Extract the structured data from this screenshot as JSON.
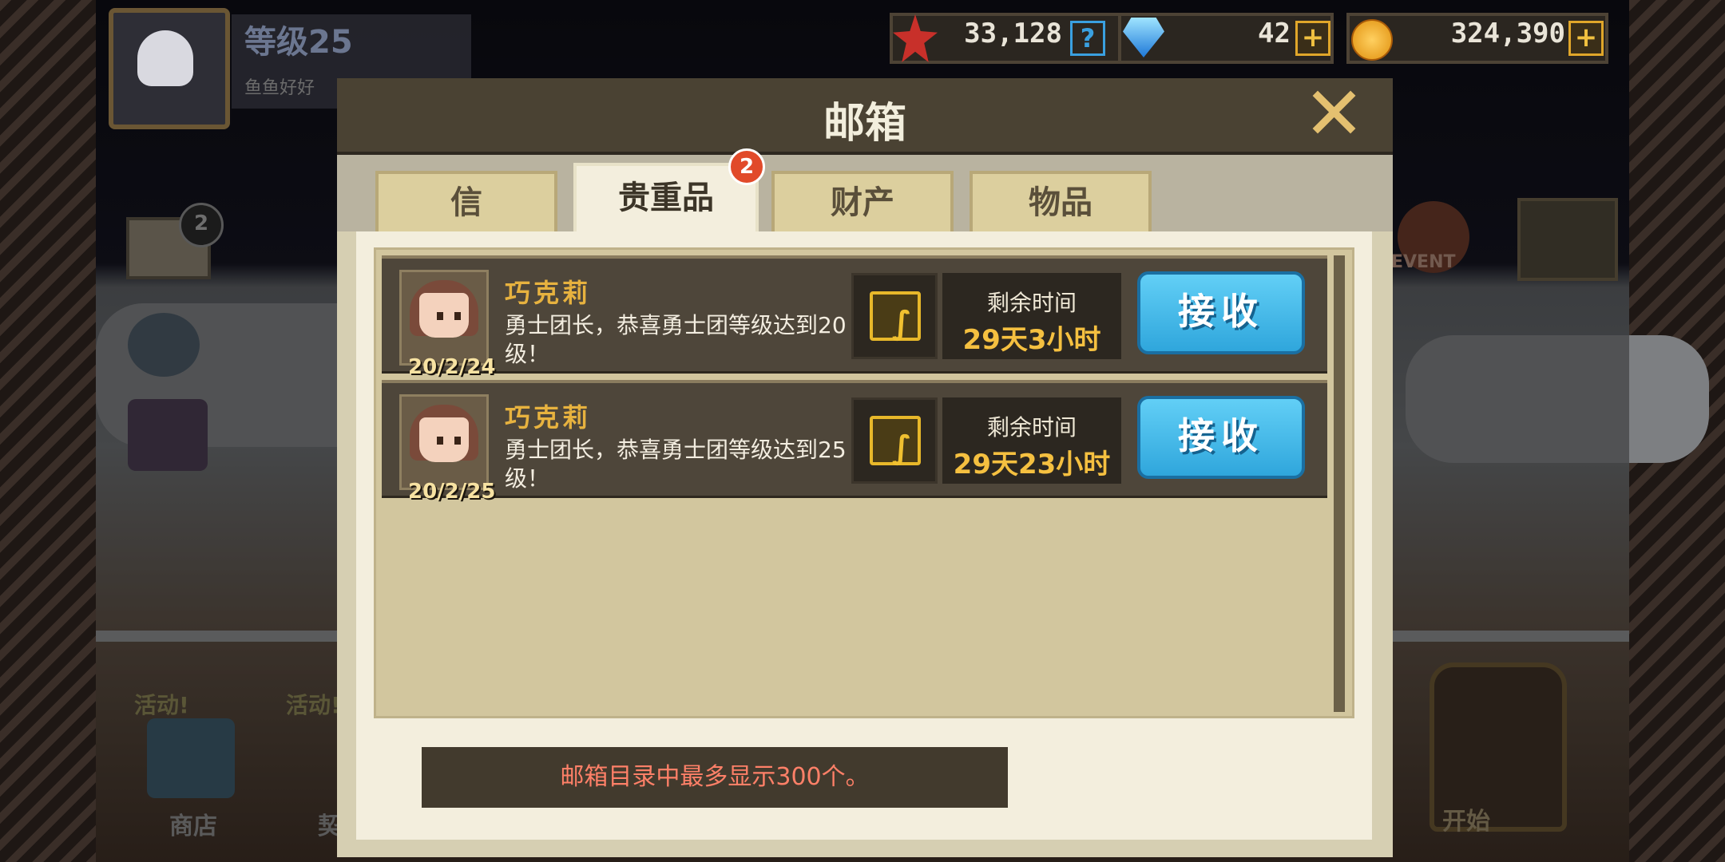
{
  "player": {
    "level_label": "等级25",
    "name": "鱼鱼好好"
  },
  "resources": {
    "medals": "33,128",
    "help_icon": "question-icon",
    "gems": "42",
    "coins": "324,390"
  },
  "dialog": {
    "title": "邮箱",
    "tabs": [
      {
        "label": "信"
      },
      {
        "label": "贵重品"
      },
      {
        "label": "财产"
      },
      {
        "label": "物品"
      }
    ],
    "active_tab_badge": "2",
    "mails": [
      {
        "sender": "巧克莉",
        "date": "20/2/24",
        "message": "勇士团长，恭喜勇士团等级达到20级！",
        "time_label": "剩余时间",
        "time_value": "29天3小时",
        "button": "接收"
      },
      {
        "sender": "巧克莉",
        "date": "20/2/25",
        "message": "勇士团长，恭喜勇士团等级达到25级！",
        "time_label": "剩余时间",
        "time_value": "29天23小时",
        "button": "接收"
      }
    ],
    "notice": "邮箱目录中最多显示300个。"
  },
  "background": {
    "mail_badge": "2",
    "event_label": "EVENT",
    "activity_1": "活动!",
    "activity_2": "活动!",
    "shop_label": "商店",
    "contract_label": "契约",
    "start_label": "开始"
  },
  "colors": {
    "accent_blue": "#2fa6dc",
    "accent_gold": "#f5c040",
    "badge_red": "#e14a2a"
  }
}
